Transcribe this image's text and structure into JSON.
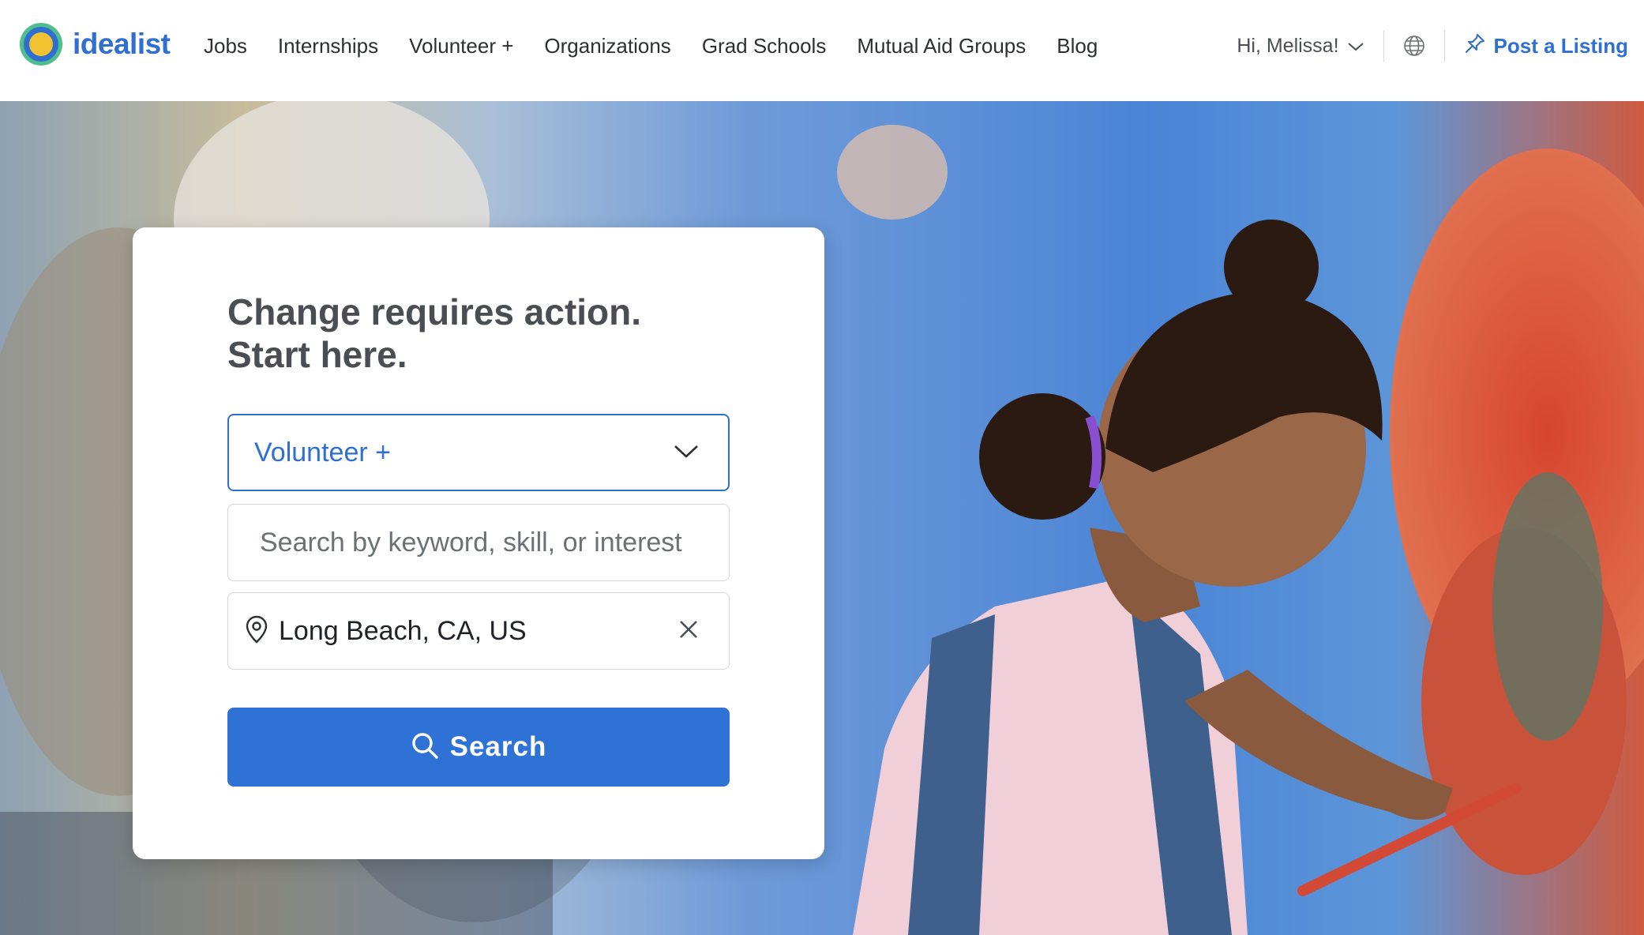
{
  "header": {
    "brand": "idealist",
    "nav": [
      "Jobs",
      "Internships",
      "Volunteer +",
      "Organizations",
      "Grad Schools",
      "Mutual Aid Groups",
      "Blog"
    ],
    "greeting": "Hi, Melissa!",
    "post_listing": "Post a Listing"
  },
  "hero": {
    "title": "Change requires action. Start here.",
    "listing_type": "Volunteer +",
    "keyword_placeholder": "Search by keyword, skill, or interest",
    "keyword_value": "",
    "location_value": "Long Beach, CA, US",
    "search_label": "Search"
  },
  "icons": {
    "logo": "idealist-logo-icon",
    "chevron": "chevron-down-icon",
    "globe": "globe-icon",
    "pin": "pushpin-icon",
    "location": "location-pin-icon",
    "clear": "close-icon",
    "search": "search-icon"
  },
  "colors": {
    "brand_blue": "#2e6fd1",
    "button_blue": "#2f72d6",
    "text": "#2d3033"
  }
}
